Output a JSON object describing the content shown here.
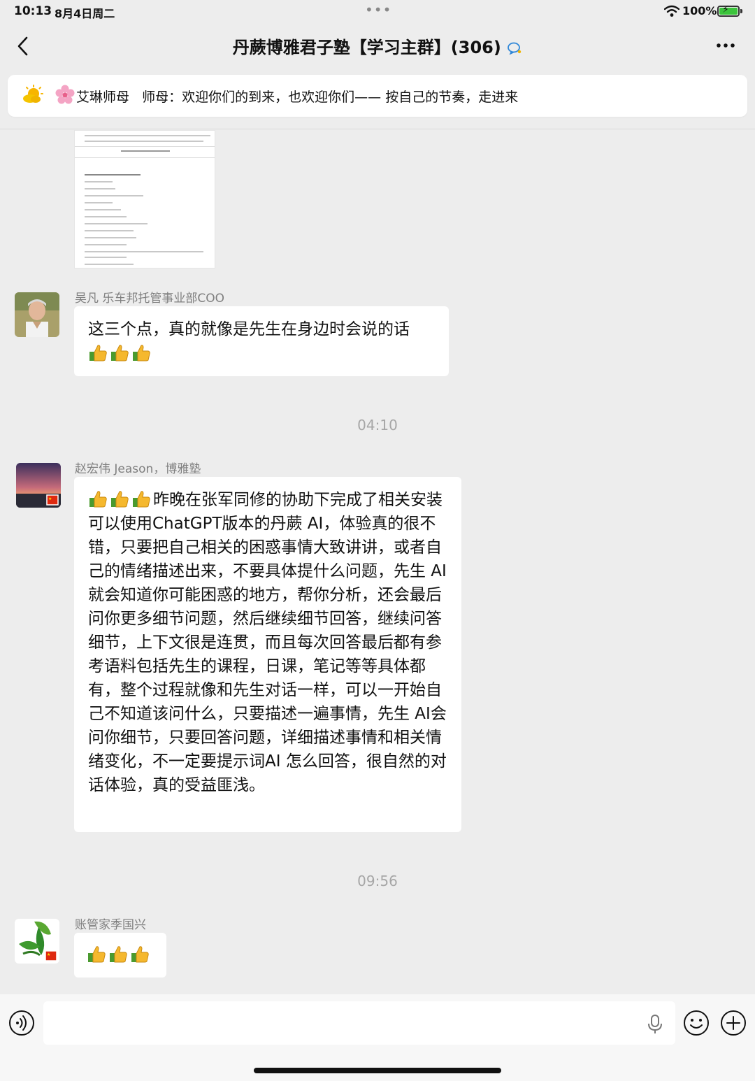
{
  "status_bar": {
    "time": "10:13",
    "date": "8月4日周二",
    "battery": "100%"
  },
  "header": {
    "title": "丹蕨博雅君子塾【学习主群】(306)"
  },
  "pinned": {
    "sender": "艾琳师母",
    "text": "师母：欢迎你们的到来，也欢迎你们—— 按自己的节奏，走进来"
  },
  "messages": [
    {
      "sender": "吴凡 乐车邦托管事业部COO",
      "text": "这三个点，真的就像是先生在身边时会说的话"
    },
    {
      "sender": "赵宏伟 Jeason，博雅塾",
      "text": "昨晚在张军同修的协助下完成了相关安装可以使用ChatGPT版本的丹蕨 AI，体验真的很不错，只要把自己相关的困惑事情大致讲讲，或者自己的情绪描述出来，不要具体提什么问题，先生 AI就会知道你可能困惑的地方，帮你分析，还会最后问你更多细节问题，然后继续细节回答，继续问答细节，上下文很是连贯，而且每次回答最后都有参考语料包括先生的课程，日课，笔记等等具体都有，整个过程就像和先生对话一样，可以一开始自己不知道该问什么，只要描述一遍事情，先生 AI会问你细节，只要回答问题，详细描述事情和相关情绪变化，不一定要提示词AI 怎么回答，很自然的对话体验，真的受益匪浅。"
    },
    {
      "sender": "账管家季国兴",
      "text": ""
    }
  ],
  "timestamps": [
    "04:10",
    "09:56"
  ],
  "icons": {
    "back": "chevron-left-icon",
    "more": "more-dots-icon",
    "voice": "voice-icon",
    "mic": "microphone-icon",
    "emoji": "emoji-icon",
    "plus": "plus-icon",
    "thumb": "thumbs-up-icon"
  },
  "colors": {
    "background": "#ededed",
    "bubble": "#ffffff",
    "sender_name": "#7f7f7f",
    "timestamp": "#a6a6a6"
  }
}
